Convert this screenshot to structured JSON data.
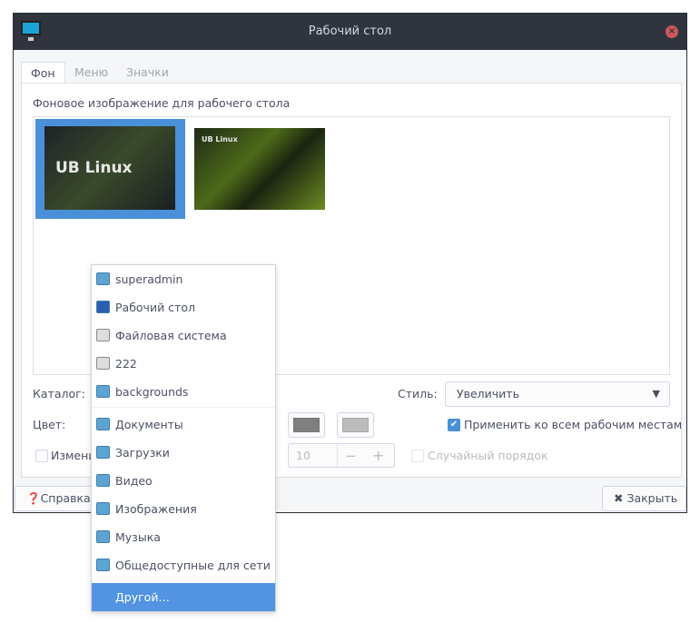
{
  "window": {
    "title": "Рабочий стол",
    "close_icon": "close-icon"
  },
  "tabs": [
    {
      "label": "Фон",
      "active": true
    },
    {
      "label": "Меню"
    },
    {
      "label": "Значки"
    }
  ],
  "background": {
    "section_label": "Фоновое изображение для рабочего стола",
    "thumbnails": [
      {
        "logo": "UB Linux",
        "selected": true
      },
      {
        "logo": "UB Linux",
        "selected": false
      }
    ],
    "catalog_label": "Каталог:",
    "style_label": "Стиль:",
    "style_value": "Увеличить",
    "color_label": "Цвет:",
    "colors": [
      "#7f7f7f",
      "#bcbcbc"
    ],
    "apply_all_label": "Применить ко всем рабочим местам",
    "apply_all_checked": true,
    "change_label": "Измени",
    "change_checked": false,
    "interval_value": "10",
    "minus": "−",
    "plus": "+",
    "random_label": "Случайный порядок",
    "random_checked": false
  },
  "buttons": {
    "help": "Справка",
    "close": "Закрыть"
  },
  "catalog_menu": {
    "items": [
      {
        "label": "superadmin",
        "icon": "home-folder-icon"
      },
      {
        "label": "Рабочий стол",
        "icon": "desktop-icon"
      },
      {
        "label": "Файловая система",
        "icon": "drive-icon"
      },
      {
        "label": "222",
        "icon": "removable-drive-icon"
      },
      {
        "label": "backgrounds",
        "icon": "folder-icon"
      },
      {
        "label": "Документы",
        "icon": "documents-folder-icon"
      },
      {
        "label": "Загрузки",
        "icon": "downloads-folder-icon"
      },
      {
        "label": "Видео",
        "icon": "videos-folder-icon"
      },
      {
        "label": "Изображения",
        "icon": "pictures-folder-icon"
      },
      {
        "label": "Музыка",
        "icon": "music-folder-icon"
      },
      {
        "label": "Общедоступные для сети",
        "icon": "public-folder-icon"
      },
      {
        "label": "Другой…",
        "selected": true
      }
    ]
  }
}
